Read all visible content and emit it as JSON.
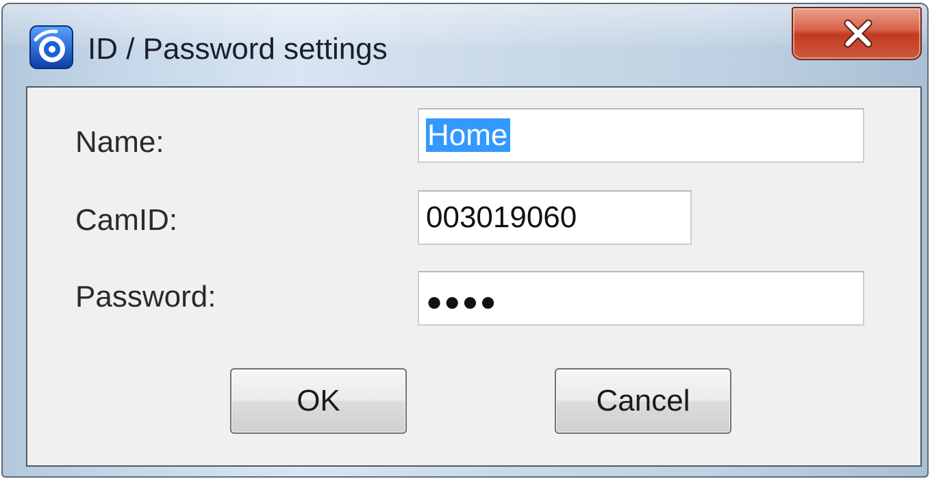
{
  "window": {
    "title": "ID / Password settings",
    "icon": "camera-app-icon",
    "close_label": "X"
  },
  "form": {
    "name": {
      "label": "Name:",
      "value": "Home",
      "selected": true
    },
    "camid": {
      "label": "CamID:",
      "value": "003019060"
    },
    "password": {
      "label": "Password:",
      "value": "●●●●"
    }
  },
  "buttons": {
    "ok_label": "OK",
    "cancel_label": "Cancel"
  },
  "colors": {
    "selection": "#3399ff",
    "close_button": "#c23a22",
    "icon_blue": "#1656c8"
  }
}
